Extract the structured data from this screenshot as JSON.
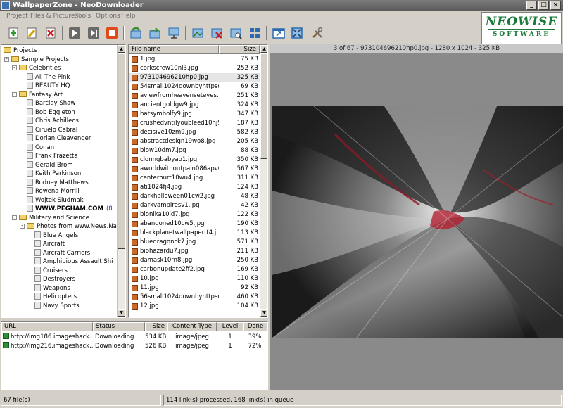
{
  "window": {
    "title": "WallpaperZone - NeoDownloader"
  },
  "menu": [
    "Project",
    "Files & Pictures",
    "Tools",
    "Options",
    "Help"
  ],
  "toolbar": [
    {
      "name": "add-project-icon",
      "color": "#2a9a2a"
    },
    {
      "name": "edit-icon",
      "color": "#d8a400"
    },
    {
      "name": "delete-icon",
      "color": "#c81e1e"
    },
    {
      "name": "start-icon",
      "color": "#555555"
    },
    {
      "name": "step-icon",
      "color": "#555555"
    },
    {
      "name": "stop-icon",
      "color": "#e04a1a"
    },
    {
      "name": "refresh-icon",
      "color": "#3a8a3a"
    },
    {
      "name": "download-icon",
      "color": "#3a8a3a"
    },
    {
      "name": "display-icon",
      "color": "#2a6ab0"
    },
    {
      "name": "picture-icon",
      "color": "#2a6ab0"
    },
    {
      "name": "delete-picture-icon",
      "color": "#c81e1e"
    },
    {
      "name": "view-picture-icon",
      "color": "#2a6ab0"
    },
    {
      "name": "thumbnails-icon",
      "color": "#2a6ab0"
    },
    {
      "name": "window-icon",
      "color": "#2a6ab0"
    },
    {
      "name": "fullscreen-icon",
      "color": "#2a6ab0"
    },
    {
      "name": "tools-icon",
      "color": "#707070"
    }
  ],
  "logo": {
    "line1": "NEOWISE",
    "line2": "SOFTWARE",
    "color": "#1b7a3a"
  },
  "tree": [
    {
      "label": "Projects",
      "level": 0,
      "type": "folder"
    },
    {
      "label": "Sample Projects",
      "level": 1,
      "type": "folder",
      "expander": "-"
    },
    {
      "label": "Celebrities",
      "level": 2,
      "type": "folder",
      "expander": "-"
    },
    {
      "label": "All The Pink",
      "level": 3,
      "type": "page"
    },
    {
      "label": "BEAUTY HQ",
      "level": 3,
      "type": "page"
    },
    {
      "label": "Fantasy Art",
      "level": 2,
      "type": "folder",
      "expander": "-"
    },
    {
      "label": "Barclay Shaw",
      "level": 3,
      "type": "page"
    },
    {
      "label": "Bob Eggleton",
      "level": 3,
      "type": "page"
    },
    {
      "label": "Chris Achilleos",
      "level": 3,
      "type": "page"
    },
    {
      "label": "Ciruelo Cabral",
      "level": 3,
      "type": "page"
    },
    {
      "label": "Dorian Cleavenger",
      "level": 3,
      "type": "page"
    },
    {
      "label": "Conan",
      "level": 3,
      "type": "page"
    },
    {
      "label": "Frank Frazetta",
      "level": 3,
      "type": "page"
    },
    {
      "label": "Gerald Brom",
      "level": 3,
      "type": "page"
    },
    {
      "label": "Keith Parkinson",
      "level": 3,
      "type": "page"
    },
    {
      "label": "Rodney Matthews",
      "level": 3,
      "type": "page"
    },
    {
      "label": "Rowena Morrill",
      "level": 3,
      "type": "page"
    },
    {
      "label": "Wojtek Siudmak",
      "level": 3,
      "type": "page"
    },
    {
      "label": "WWW.PEGHAM.COM",
      "level": 3,
      "type": "page",
      "bold": true,
      "extra": "(8"
    },
    {
      "label": "Military and Science",
      "level": 2,
      "type": "folder",
      "expander": "-"
    },
    {
      "label": "Photos from www.News.Na",
      "level": 3,
      "type": "folder",
      "expander": "-"
    },
    {
      "label": "Blue Angels",
      "level": 4,
      "type": "page"
    },
    {
      "label": "Aircraft",
      "level": 4,
      "type": "page"
    },
    {
      "label": "Aircraft Carriers",
      "level": 4,
      "type": "page"
    },
    {
      "label": "Amphibious Assault Shi",
      "level": 4,
      "type": "page"
    },
    {
      "label": "Cruisers",
      "level": 4,
      "type": "page"
    },
    {
      "label": "Destroyers",
      "level": 4,
      "type": "page"
    },
    {
      "label": "Weapons",
      "level": 4,
      "type": "page"
    },
    {
      "label": "Helicopters",
      "level": 4,
      "type": "page"
    },
    {
      "label": "Navy Sports",
      "level": 4,
      "type": "page"
    }
  ],
  "files": {
    "headers": {
      "name": "File name",
      "size": "Size"
    },
    "selected_index": 2,
    "rows": [
      {
        "name": "1.jpg",
        "size": "75 KB"
      },
      {
        "name": "corkscrew10nl3.jpg",
        "size": "252 KB"
      },
      {
        "name": "973104696210hp0.jpg",
        "size": "325 KB"
      },
      {
        "name": "54small1024downbyhttpso...",
        "size": "69 KB"
      },
      {
        "name": "aviewfromheavenseteyes...",
        "size": "251 KB"
      },
      {
        "name": "ancientgoldgw9.jpg",
        "size": "324 KB"
      },
      {
        "name": "batsymbolfy9.jpg",
        "size": "347 KB"
      },
      {
        "name": "crushedvntilyoubleed10hj9...",
        "size": "187 KB"
      },
      {
        "name": "decisive10zm9.jpg",
        "size": "582 KB"
      },
      {
        "name": "abstractdesign19wo8.jpg",
        "size": "205 KB"
      },
      {
        "name": "blow10dm7.jpg",
        "size": "88 KB"
      },
      {
        "name": "clonngbabyao1.jpg",
        "size": "350 KB"
      },
      {
        "name": "aworldwithoutpain086apv0...",
        "size": "567 KB"
      },
      {
        "name": "centerhurt10wu4.jpg",
        "size": "311 KB"
      },
      {
        "name": "ati1024fj4.jpg",
        "size": "124 KB"
      },
      {
        "name": "darkhalloween01cw2.jpg",
        "size": "48 KB"
      },
      {
        "name": "darkvampiresv1.jpg",
        "size": "42 KB"
      },
      {
        "name": "bionika10jd7.jpg",
        "size": "122 KB"
      },
      {
        "name": "abandoned10cw5.jpg",
        "size": "190 KB"
      },
      {
        "name": "blackplanetwallpapertt4.jpg",
        "size": "113 KB"
      },
      {
        "name": "bluedragonck7.jpg",
        "size": "571 KB"
      },
      {
        "name": "biohazardu7.jpg",
        "size": "211 KB"
      },
      {
        "name": "damask10rn8.jpg",
        "size": "250 KB"
      },
      {
        "name": "carbonupdate2ff2.jpg",
        "size": "169 KB"
      },
      {
        "name": "10.jpg",
        "size": "110 KB"
      },
      {
        "name": "11.jpg",
        "size": "92 KB"
      },
      {
        "name": "56small1024downbyhttpso...",
        "size": "460 KB"
      },
      {
        "name": "12.jpg",
        "size": "104 KB"
      }
    ]
  },
  "preview": {
    "caption": "3 of 67 - 973104696210hp0.jpg - 1280 x 1024 - 325 KB"
  },
  "downloads": {
    "headers": [
      "URL",
      "Status",
      "Size",
      "Content Type",
      "Level",
      "Done"
    ],
    "rows": [
      {
        "url": "http://img186.imageshack...",
        "status": "Downloading",
        "size": "534 KB",
        "type": "image/jpeg",
        "level": "1",
        "done": "39%"
      },
      {
        "url": "http://img216.imageshack...",
        "status": "Downloading",
        "size": "526 KB",
        "type": "image/jpeg",
        "level": "1",
        "done": "72%"
      }
    ]
  },
  "status": {
    "files": "67 file(s)",
    "links": "114 link(s) processed, 168 link(s) in queue"
  }
}
